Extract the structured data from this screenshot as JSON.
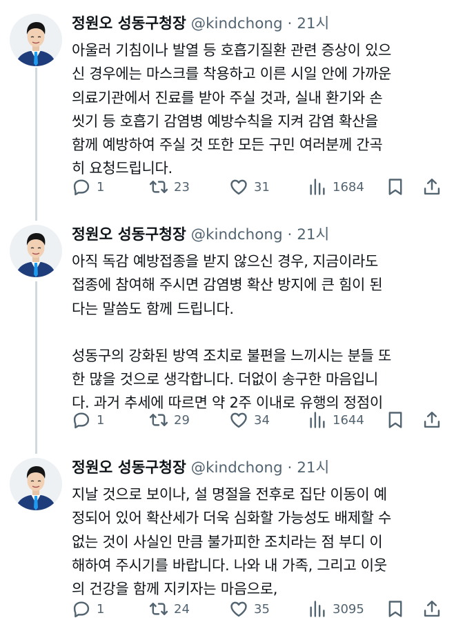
{
  "tweets": [
    {
      "author_name": "정원오 성동구청장",
      "handle": "@kindchong",
      "separator": "·",
      "time": "21시",
      "lines": [
        "아울러 기침이나 발열 등 호흡기질환 관련 증상이 있으",
        "신 경우에는 마스크를 착용하고 이른 시일 안에 가까운",
        "의료기관에서 진료를 받아 주실 것과, 실내 환기와 손",
        "씻기 등 호흡기 감염병 예방수칙을 지켜 감염 확산을",
        "함께 예방하여 주실 것 또한 모든 구민 여러분께 간곡",
        "히 요청드립니다."
      ],
      "replies": "1",
      "retweets": "23",
      "likes": "31",
      "views": "1684"
    },
    {
      "author_name": "정원오 성동구청장",
      "handle": "@kindchong",
      "separator": "·",
      "time": "21시",
      "lines": [
        "아직 독감 예방접종을 받지 않으신 경우, 지금이라도",
        "접종에 참여해 주시면 감염병 확산 방지에 큰 힘이 된",
        "다는 말씀도 함께 드립니다."
      ],
      "lines2": [
        "성동구의 강화된 방역 조치로 불편을 느끼시는 분들 또",
        "한 많을 것으로 생각합니다. 더없이 송구한 마음입니",
        "다. 과거 추세에 따르면 약 2주 이내로 유행의 정점이"
      ],
      "replies": "1",
      "retweets": "29",
      "likes": "34",
      "views": "1644"
    },
    {
      "author_name": "정원오 성동구청장",
      "handle": "@kindchong",
      "separator": "·",
      "time": "21시",
      "lines": [
        "지날 것으로 보이나, 설 명절을 전후로 집단 이동이 예",
        "정되어 있어 확산세가 더욱 심화할 가능성도 배제할 수",
        "없는 것이 사실인 만큼 불가피한 조치라는 점 부디 이",
        "해하여 주시기를 바랍니다. 나와 내 가족, 그리고 이웃",
        "의 건강을 함께 지키자는 마음으로,"
      ],
      "replies": "1",
      "retweets": "24",
      "likes": "35",
      "views": "3095"
    }
  ],
  "icons": [
    "reply-icon",
    "retweet-icon",
    "like-icon",
    "views-icon",
    "bookmark-icon",
    "share-icon"
  ],
  "colors": {
    "text": "#0f1419",
    "secondary": "#536471",
    "thread_line": "#cfd9de",
    "suit": "#1f3d7a",
    "tie": "#1d9bf0"
  }
}
